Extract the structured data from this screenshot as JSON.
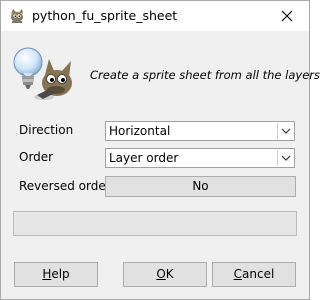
{
  "window": {
    "title": "python_fu_sprite_sheet",
    "close_icon": "close-icon"
  },
  "header": {
    "description": "Create a sprite sheet from all the layers."
  },
  "form": {
    "direction": {
      "label": "Direction",
      "value": "Horizontal"
    },
    "order": {
      "label": "Order",
      "value": "Layer order"
    },
    "reversed_order": {
      "label": "Reversed order",
      "value": "No"
    }
  },
  "progress": {
    "fraction": 0
  },
  "buttons": {
    "help": {
      "mnemonic": "H",
      "rest": "elp"
    },
    "ok": {
      "mnemonic": "O",
      "rest": "K"
    },
    "cancel": {
      "mnemonic": "C",
      "rest": "ancel"
    }
  }
}
